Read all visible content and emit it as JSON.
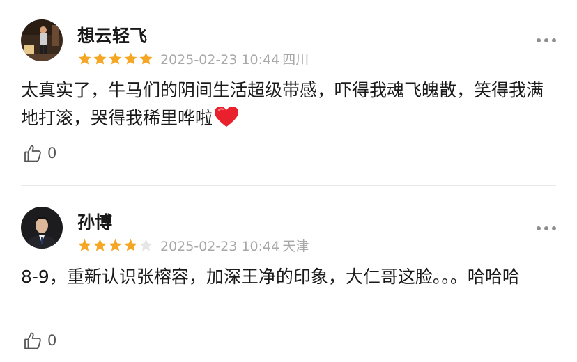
{
  "reviews": [
    {
      "username": "想云轻飞",
      "rating": 5,
      "max_rating": 5,
      "date": "2025-02-23 10:44",
      "location": "四川",
      "content": "太真实了，牛马们的阴间生活超级带感，吓得我魂飞魄散，笑得我满地打滚，哭得我稀里哗啦",
      "emoji": "red-heart",
      "likes": "0"
    },
    {
      "username": "孙博",
      "rating": 4,
      "max_rating": 5,
      "date": "2025-02-23 10:44",
      "location": "天津",
      "content": "8-9，重新认识张榕容，加深王净的印象，大仁哥这脸。。。哈哈哈",
      "likes": "0"
    }
  ],
  "colors": {
    "star_filled": "#F5A623",
    "star_empty": "#E6E6E6",
    "meta_text": "#A8A8A8",
    "heart": "#E8212D"
  },
  "icons": [
    "thumbs-up-icon",
    "more-icon",
    "star-icon",
    "heart-emoji"
  ]
}
